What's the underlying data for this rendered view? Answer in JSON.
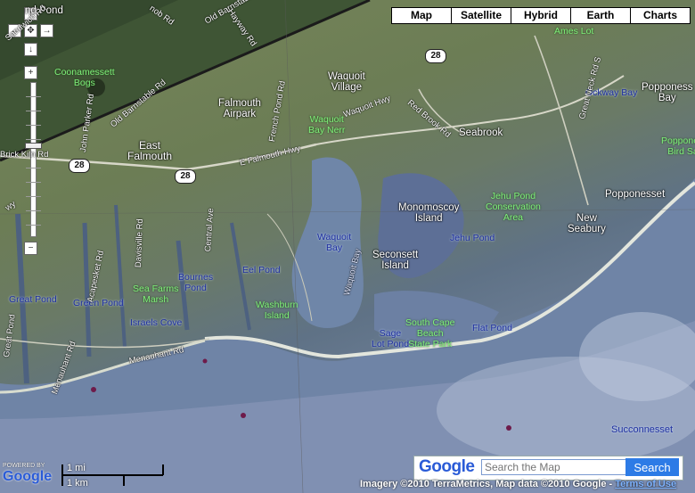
{
  "map_types": [
    {
      "label": "Map",
      "name": "map-type-map"
    },
    {
      "label": "Satellite",
      "name": "map-type-satellite"
    },
    {
      "label": "Hybrid",
      "name": "map-type-hybrid"
    },
    {
      "label": "Earth",
      "name": "map-type-earth"
    },
    {
      "label": "Charts",
      "name": "map-type-charts"
    }
  ],
  "nav": {
    "up": "↑",
    "left": "←",
    "center": "✥",
    "right": "→",
    "down": "↓",
    "zoom_in": "+",
    "zoom_out": "−"
  },
  "labels": {
    "coonamessett_bogs": "Coonamessett\nBogs",
    "falmouth_airpark": "Falmouth\nAirpark",
    "waquoit_village": "Waquoit\nVillage",
    "waquoit_bay_nerr": "Waquoit\nBay Nerr",
    "east_falmouth": "East\nFalmouth",
    "seabrook": "Seabrook",
    "jehu_pond_conservation": "Jehu Pond\nConservation\nArea",
    "monomoscoy_island": "Monomoscoy\nIsland",
    "jehu_pond": "Jehu Pond",
    "new_seabury": "New\nSeabury",
    "popponesset": "Popponesset",
    "popponesset_bay": "Popponess\nBay",
    "ockway_bay": "Ockway Bay",
    "popponesset_bird": "Popponess\nBird Sar",
    "seconsett_island": "Seconsett\nIsland",
    "waquoit_bay": "Waquoit\nBay",
    "eel_pond": "Eel Pond",
    "washburn_island": "Washburn\nIsland",
    "great_pond": "Great Pond",
    "green_pond": "Green Pond",
    "sea_farms_marsh": "Sea Farms\nMarsh",
    "bournes_pond": "Bournes\nPond",
    "israels_cove": "Israels Cove",
    "south_cape_beach": "South Cape\nBeach\nState Park",
    "sage_lot_pond": "Sage\nLot Pond",
    "flat_pond": "Flat Pond",
    "ames_lot": "Ames Lot",
    "succonnesset": "Succonnesset",
    "nd_pond": "nd Pond",
    "sandwich_rd": "Sandwich Rd",
    "john_parker_rd": "John Parker Rd",
    "old_barnstable_rd": "Old Barnstable Rd",
    "old_barnstable_rd_top": "Old Barnstable Rd",
    "hayway_rd": "Hayway Rd",
    "nob_rd": "nob Rd",
    "brick_kiln_rd": "Brick Kiln Rd",
    "frenchpond_rd": "French Pond Rd",
    "waquoit_hwy": "Waquoit Hwy",
    "e_falmouth_hwy": "E Falmouth Hwy",
    "red_brook_rd": "Red Brook Rd",
    "great_neck_rd_s": "Great Neck Rd S",
    "acapesket_rd": "Acapesket Rd",
    "davisville_rd": "Davisville Rd",
    "central_ave": "Central Ave",
    "menauhant_rd": "Menauhant Rd",
    "menauhant_rd2": "Menauhant Rd",
    "great_pond_rd": "Great Pond",
    "waquoit_bay_rd": "Waquoit Bay",
    "hwy_partial": "wy"
  },
  "shields": {
    "route28_a": "28",
    "route28_b": "28",
    "route28_c": "28"
  },
  "search": {
    "logo": "Google",
    "placeholder": "Search the Map",
    "button": "Search"
  },
  "scale": {
    "miles": "1 mi",
    "km": "1 km"
  },
  "attribution": {
    "text": "Imagery ©2010 TerraMetrics, Map data ©2010 Google - ",
    "terms": "Terms of Use"
  },
  "powered_by": {
    "text": "POWERED BY",
    "logo": "Google"
  }
}
